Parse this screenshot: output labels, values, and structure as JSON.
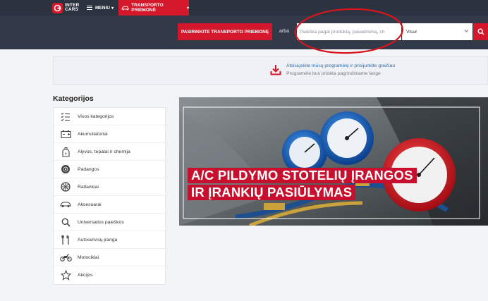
{
  "header": {
    "logo_text_line1": "INTER",
    "logo_text_line2": "CARS",
    "menu_label": "MENIU",
    "vehicle_tab_label": "TRANSPORTO PRIEMONĖ"
  },
  "search": {
    "select_vehicle_label": "PASIRINKITE TRANSPORTO PRIEMONĘ",
    "or_label": "arba",
    "placeholder": "Paieška pagal produktą, pavadinimą, ch",
    "category_value": "Visur"
  },
  "app_banner": {
    "line1": "Atsisiųskite mūsų programėlę ir prisijunkite greičiau",
    "line2": "Programėlė bus pridėta pagrindiniame lange"
  },
  "categories": {
    "title": "Kategorijos",
    "items": [
      {
        "label": "Visos kategorijos",
        "icon": "list-icon"
      },
      {
        "label": "Akumuliatoriai",
        "icon": "battery-icon"
      },
      {
        "label": "Alyvos, tepalai ir chemija",
        "icon": "oil-can-icon"
      },
      {
        "label": "Padangos",
        "icon": "tire-icon"
      },
      {
        "label": "Ratlankiai",
        "icon": "rim-icon"
      },
      {
        "label": "Aksesuarai",
        "icon": "car-accessory-icon"
      },
      {
        "label": "Universalios paieškos",
        "icon": "search-icon"
      },
      {
        "label": "Autoservisų įranga",
        "icon": "tools-icon"
      },
      {
        "label": "Motociklai",
        "icon": "motorcycle-icon"
      },
      {
        "label": "Akcijos",
        "icon": "star-icon"
      }
    ]
  },
  "hero": {
    "line1": "A/C PILDYMO STOTELIŲ ĮRANGOS",
    "line2": "IR ĮRANKIŲ PASIŪLYMAS"
  },
  "colors": {
    "brand_red": "#d5172b",
    "topbar": "#2b3240",
    "searchband": "#323a49",
    "annotation_ellipse": "#d8151c"
  }
}
